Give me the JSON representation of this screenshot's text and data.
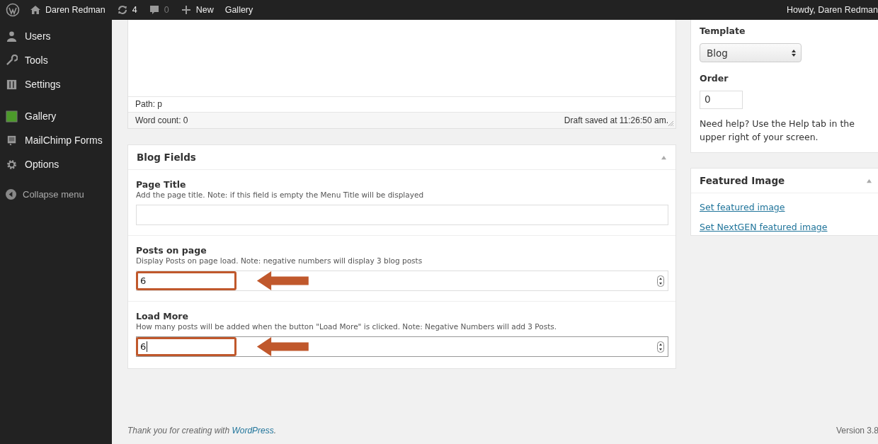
{
  "admin_bar": {
    "site_name": "Daren Redman",
    "updates": "4",
    "comments": "0",
    "new_label": "New",
    "gallery_label": "Gallery",
    "greeting": "Howdy, Daren Redman"
  },
  "sidebar": {
    "items": [
      {
        "label": "Users"
      },
      {
        "label": "Tools"
      },
      {
        "label": "Settings"
      },
      {
        "label": "Gallery"
      },
      {
        "label": "MailChimp Forms"
      },
      {
        "label": "Options"
      }
    ],
    "collapse_label": "Collapse menu"
  },
  "editor": {
    "path": "Path: p",
    "word_count": "Word count: 0",
    "draft_status": "Draft saved at 11:26:50 am."
  },
  "blog_fields": {
    "title": "Blog Fields",
    "fields": [
      {
        "kind": "text",
        "label": "Page Title",
        "description": "Add the page title. Note: if this field is empty the Menu Title will be displayed",
        "highlighted": false,
        "focused": false
      },
      {
        "kind": "number",
        "label": "Posts on page",
        "description": "Display Posts on page load. Note: negative numbers will display 3 blog posts",
        "value": "6",
        "highlighted": true,
        "focused": false
      },
      {
        "kind": "number",
        "label": "Load More",
        "description": "How many posts will be added when the button \"Load More\" is clicked. Note: Negative Numbers will add 3 Posts.",
        "value": "6",
        "highlighted": true,
        "focused": true
      }
    ]
  },
  "page_attributes": {
    "template_label": "Template",
    "template_value": "Blog",
    "order_label": "Order",
    "order_value": "0",
    "help": "Need help? Use the Help tab in the upper right of your screen."
  },
  "featured_image": {
    "title": "Featured Image",
    "links": [
      "Set featured image",
      "Set NextGEN featured image"
    ]
  },
  "footer": {
    "thanks": "Thank you for creating with",
    "link": "WordPress",
    "end": ".",
    "version": "Version 3.8"
  }
}
